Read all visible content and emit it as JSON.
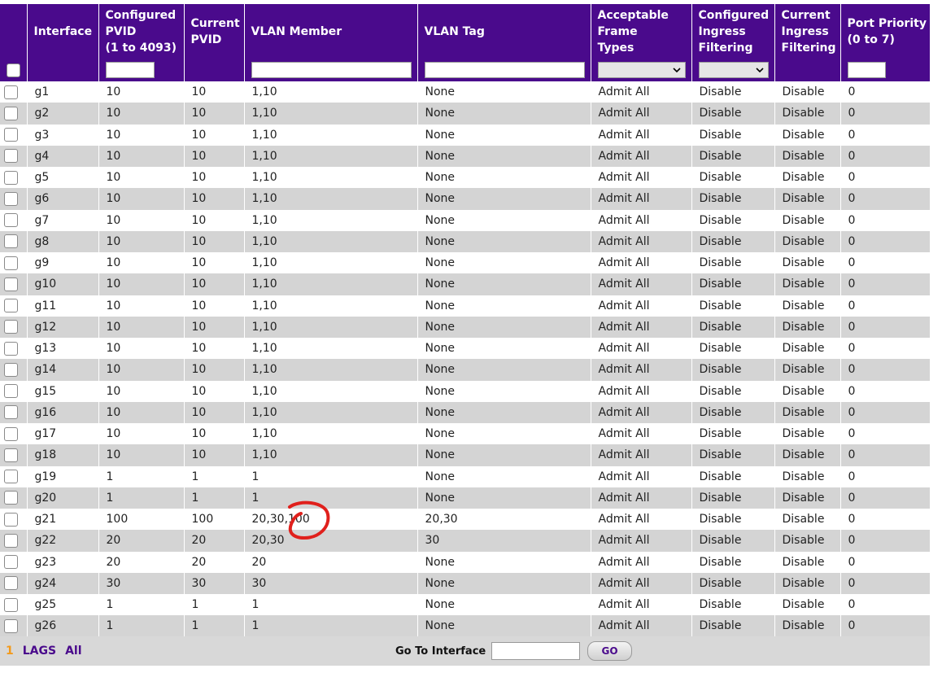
{
  "columns": {
    "interface": "Interface",
    "configured_pvid": [
      "Configured",
      "PVID",
      "(1 to 4093)"
    ],
    "current_pvid": [
      "Current",
      "PVID"
    ],
    "vlan_member": "VLAN Member",
    "vlan_tag": "VLAN Tag",
    "acceptable_frame_types": [
      "Acceptable",
      "Frame",
      "Types"
    ],
    "configured_ingress_filtering": [
      "Configured",
      "Ingress",
      "Filtering"
    ],
    "current_ingress_filtering": [
      "Current",
      "Ingress",
      "Filtering"
    ],
    "port_priority": [
      "Port Priority",
      "(0 to 7)"
    ]
  },
  "filters": {
    "configured_pvid": "",
    "vlan_member": "",
    "vlan_tag": "",
    "acceptable_frame_types": "",
    "configured_ingress_filtering": "",
    "port_priority": ""
  },
  "rows": [
    [
      "g1",
      "10",
      "10",
      "1,10",
      "None",
      "Admit All",
      "Disable",
      "Disable",
      "0"
    ],
    [
      "g2",
      "10",
      "10",
      "1,10",
      "None",
      "Admit All",
      "Disable",
      "Disable",
      "0"
    ],
    [
      "g3",
      "10",
      "10",
      "1,10",
      "None",
      "Admit All",
      "Disable",
      "Disable",
      "0"
    ],
    [
      "g4",
      "10",
      "10",
      "1,10",
      "None",
      "Admit All",
      "Disable",
      "Disable",
      "0"
    ],
    [
      "g5",
      "10",
      "10",
      "1,10",
      "None",
      "Admit All",
      "Disable",
      "Disable",
      "0"
    ],
    [
      "g6",
      "10",
      "10",
      "1,10",
      "None",
      "Admit All",
      "Disable",
      "Disable",
      "0"
    ],
    [
      "g7",
      "10",
      "10",
      "1,10",
      "None",
      "Admit All",
      "Disable",
      "Disable",
      "0"
    ],
    [
      "g8",
      "10",
      "10",
      "1,10",
      "None",
      "Admit All",
      "Disable",
      "Disable",
      "0"
    ],
    [
      "g9",
      "10",
      "10",
      "1,10",
      "None",
      "Admit All",
      "Disable",
      "Disable",
      "0"
    ],
    [
      "g10",
      "10",
      "10",
      "1,10",
      "None",
      "Admit All",
      "Disable",
      "Disable",
      "0"
    ],
    [
      "g11",
      "10",
      "10",
      "1,10",
      "None",
      "Admit All",
      "Disable",
      "Disable",
      "0"
    ],
    [
      "g12",
      "10",
      "10",
      "1,10",
      "None",
      "Admit All",
      "Disable",
      "Disable",
      "0"
    ],
    [
      "g13",
      "10",
      "10",
      "1,10",
      "None",
      "Admit All",
      "Disable",
      "Disable",
      "0"
    ],
    [
      "g14",
      "10",
      "10",
      "1,10",
      "None",
      "Admit All",
      "Disable",
      "Disable",
      "0"
    ],
    [
      "g15",
      "10",
      "10",
      "1,10",
      "None",
      "Admit All",
      "Disable",
      "Disable",
      "0"
    ],
    [
      "g16",
      "10",
      "10",
      "1,10",
      "None",
      "Admit All",
      "Disable",
      "Disable",
      "0"
    ],
    [
      "g17",
      "10",
      "10",
      "1,10",
      "None",
      "Admit All",
      "Disable",
      "Disable",
      "0"
    ],
    [
      "g18",
      "10",
      "10",
      "1,10",
      "None",
      "Admit All",
      "Disable",
      "Disable",
      "0"
    ],
    [
      "g19",
      "1",
      "1",
      "1",
      "None",
      "Admit All",
      "Disable",
      "Disable",
      "0"
    ],
    [
      "g20",
      "1",
      "1",
      "1",
      "None",
      "Admit All",
      "Disable",
      "Disable",
      "0"
    ],
    [
      "g21",
      "100",
      "100",
      "20,30,100",
      "20,30",
      "Admit All",
      "Disable",
      "Disable",
      "0"
    ],
    [
      "g22",
      "20",
      "20",
      "20,30",
      "30",
      "Admit All",
      "Disable",
      "Disable",
      "0"
    ],
    [
      "g23",
      "20",
      "20",
      "20",
      "None",
      "Admit All",
      "Disable",
      "Disable",
      "0"
    ],
    [
      "g24",
      "30",
      "30",
      "30",
      "None",
      "Admit All",
      "Disable",
      "Disable",
      "0"
    ],
    [
      "g25",
      "1",
      "1",
      "1",
      "None",
      "Admit All",
      "Disable",
      "Disable",
      "0"
    ],
    [
      "g26",
      "1",
      "1",
      "1",
      "None",
      "Admit All",
      "Disable",
      "Disable",
      "0"
    ]
  ],
  "footer": {
    "page": "1",
    "lags_label": "LAGS",
    "all_label": "All",
    "goto_label": "Go To Interface",
    "goto_value": "",
    "go_button": "GO"
  },
  "colors": {
    "header_bg": "#4a0a8c",
    "row_alt_bg": "#d4d4d4",
    "page_number": "#f39a1b",
    "annotation": "#e0201c"
  },
  "icons": {
    "dropdown": "chevron-down-icon",
    "annotation": "red-circle-annotation"
  }
}
